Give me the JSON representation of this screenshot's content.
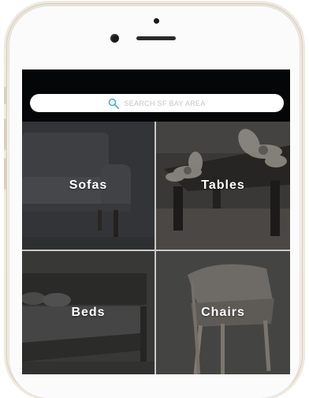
{
  "search": {
    "placeholder": "SEARCH SF BAY AREA",
    "icon": "search-icon"
  },
  "categories": [
    {
      "label": "Sofas"
    },
    {
      "label": "Tables"
    },
    {
      "label": "Beds"
    },
    {
      "label": "Chairs"
    }
  ],
  "colors": {
    "accent": "#4aaee0",
    "topbar": "#050608",
    "overlay": "#2b2b2b"
  }
}
